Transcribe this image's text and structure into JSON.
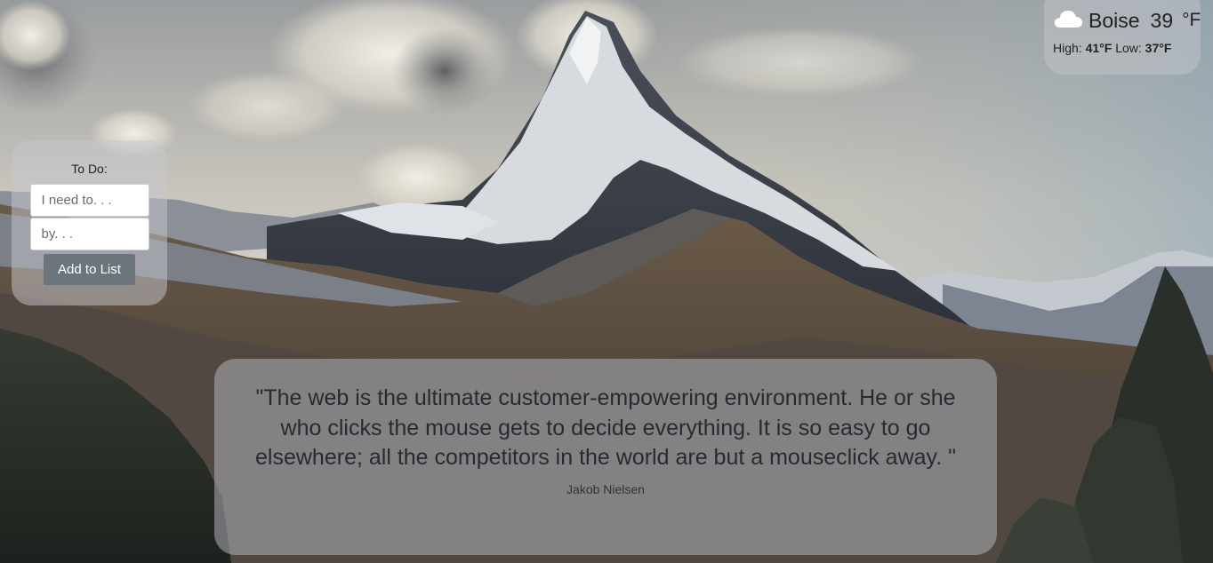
{
  "weather": {
    "icon": "cloud-icon",
    "city": "Boise",
    "temperature": "39",
    "unit": "°F",
    "high_label": "High:",
    "high_value": "41°F",
    "low_label": "Low:",
    "low_value": "37°F"
  },
  "todo": {
    "title": "To Do:",
    "task_placeholder": "I need to. . .",
    "task_value": "",
    "date_placeholder": "by. . .",
    "date_value": "",
    "add_button_label": "Add to List"
  },
  "quote": {
    "text": "\"The web is the ultimate customer-empowering environment. He or she who clicks the mouse gets to decide everything. It is so easy to go elsewhere; all the competitors in the world are but a mouseclick away. \"",
    "author": "Jakob Nielsen"
  },
  "colors": {
    "button_bg": "#6c757d",
    "text_dark": "#262b33",
    "panel_bg": "rgba(200,200,205,0.5)"
  }
}
